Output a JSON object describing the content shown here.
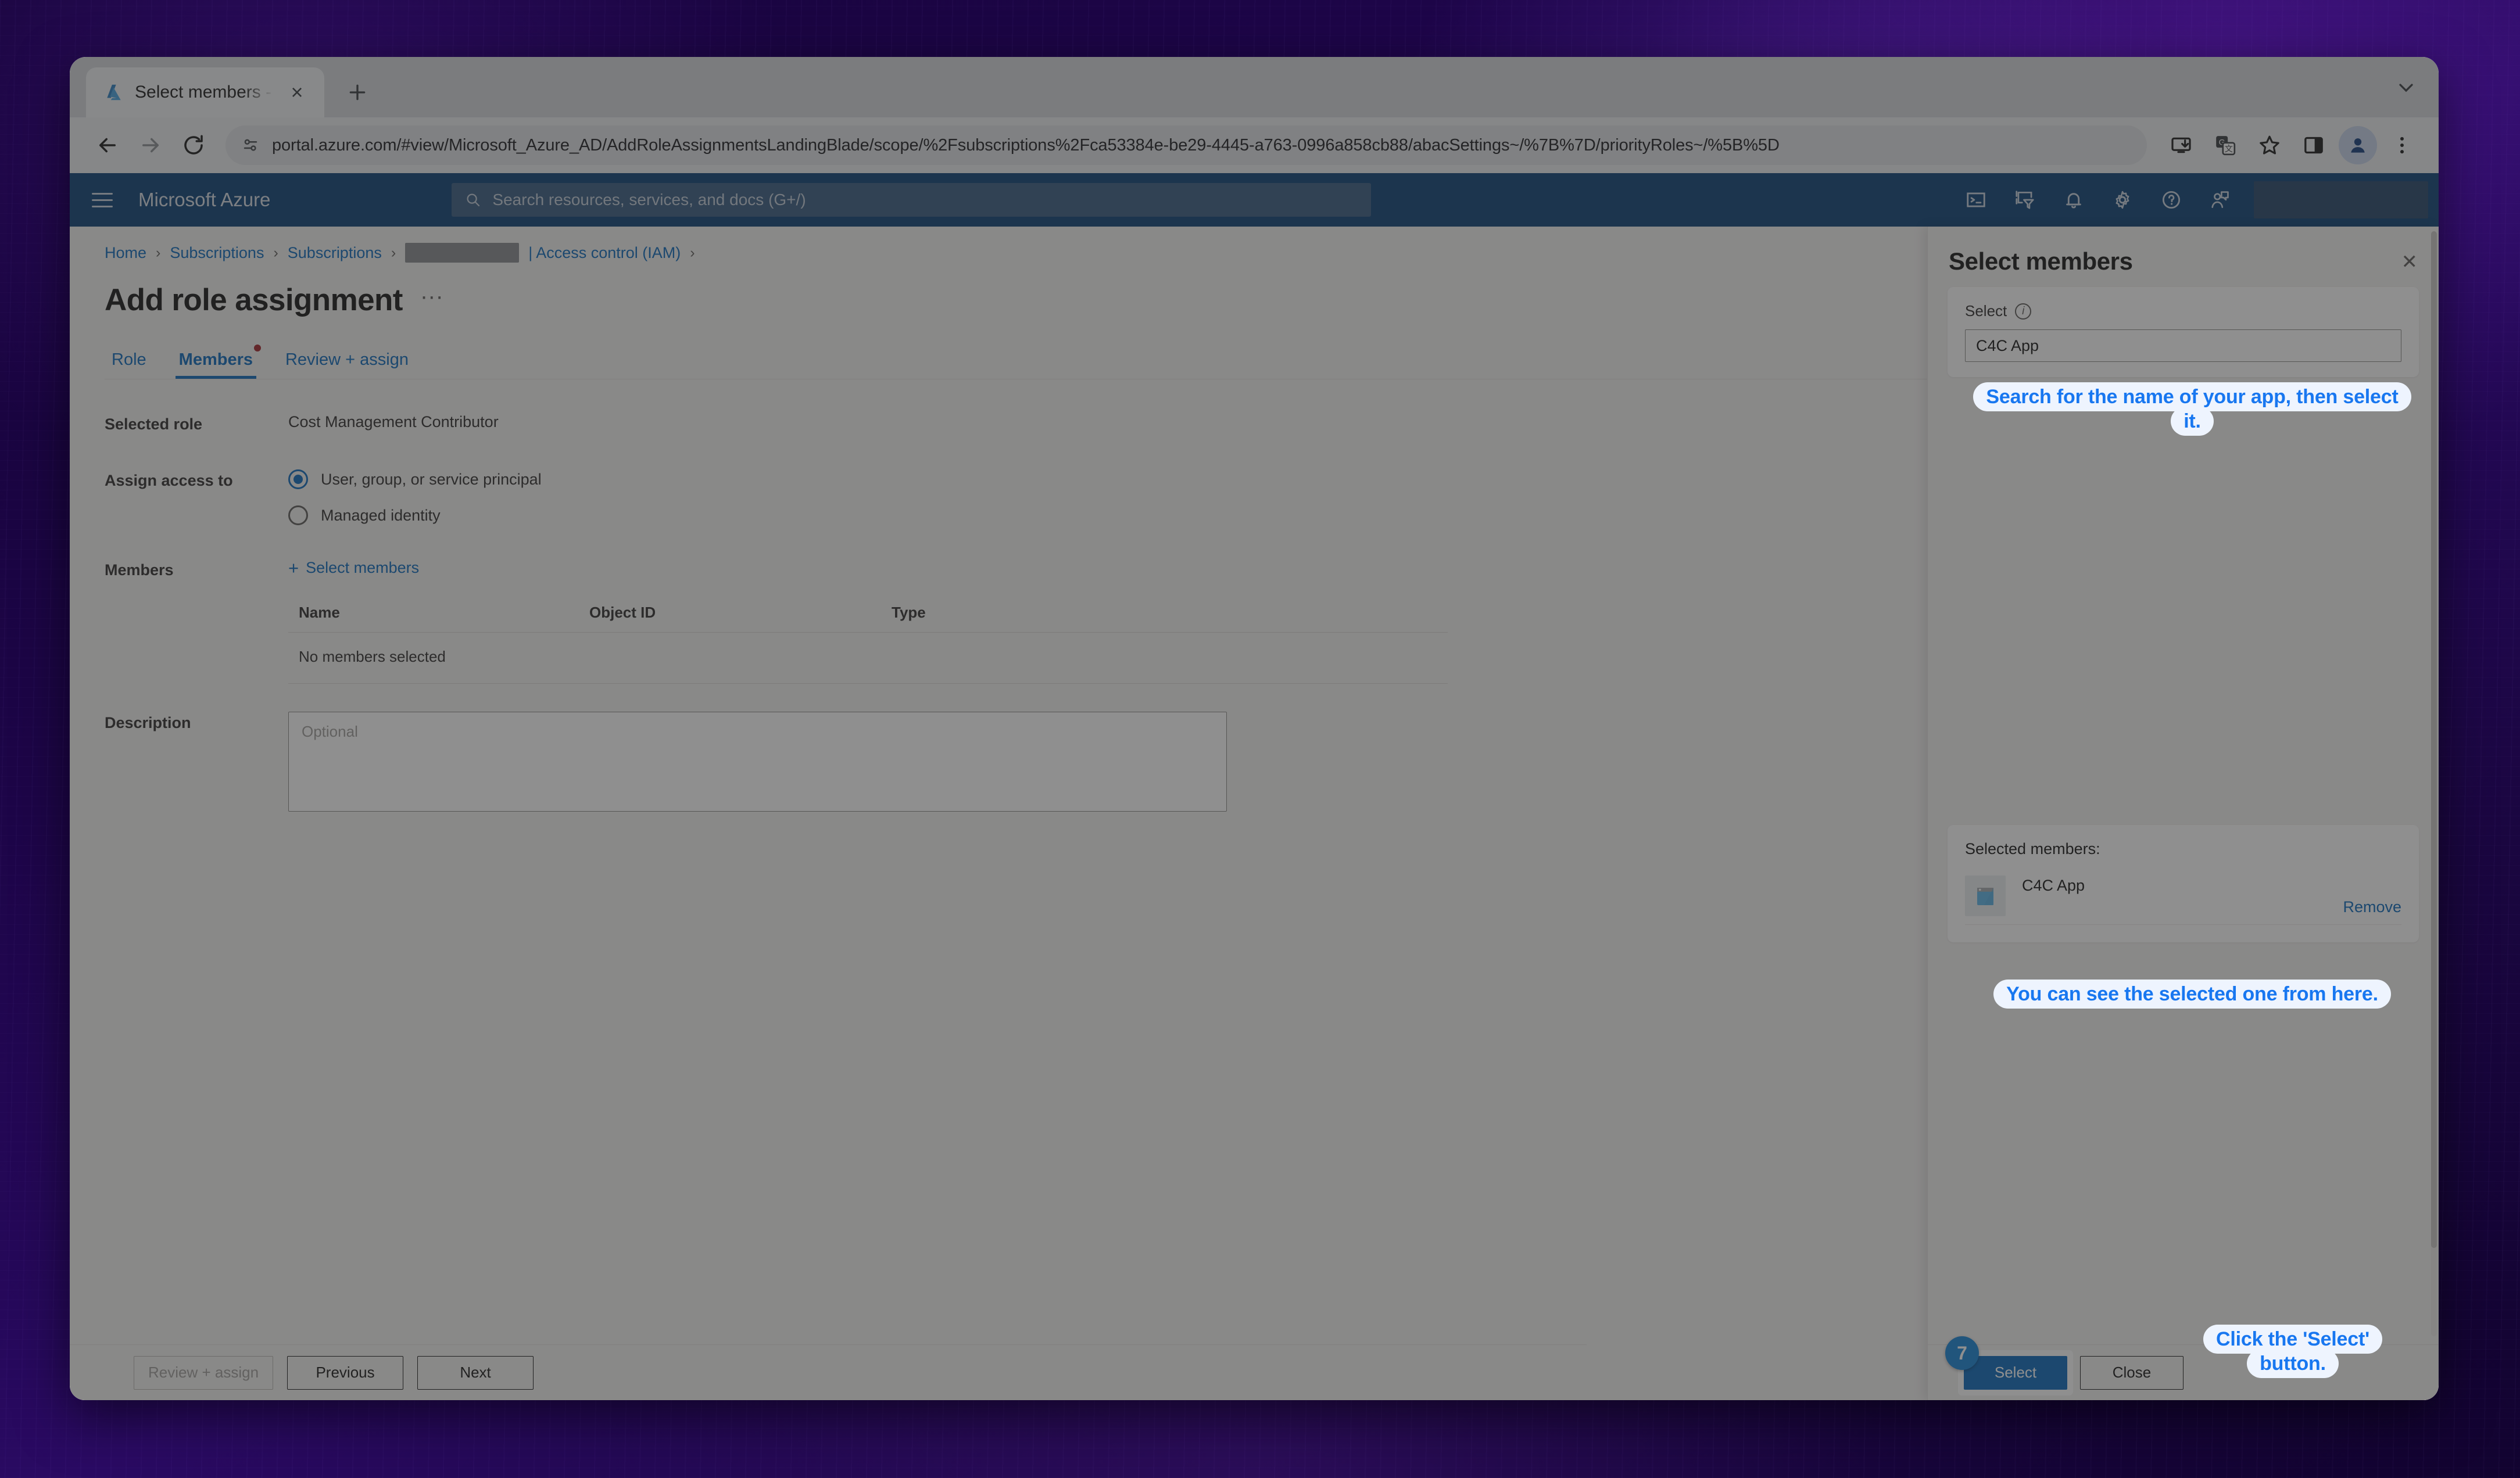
{
  "browser": {
    "tab": {
      "title": "Select members - Microsoft A",
      "favicon": "azure-logo-icon",
      "close": "×"
    },
    "newtab_label": "+",
    "window_chevron": "⌄",
    "nav": {
      "back": "←",
      "forward": "→",
      "reload": "⟳"
    },
    "omnibox": {
      "site_icon": "site-settings-icon",
      "url": "portal.azure.com/#view/Microsoft_Azure_AD/AddRoleAssignmentsLandingBlade/scope/%2Fsubscriptions%2Fca53384e-be29-4445-a763-0996a858cb88/abacSettings~/%7B%7D/priorityRoles~/%5B%5D"
    },
    "toolbar_icons": [
      "install-app-icon",
      "translate-icon",
      "bookmark-star-icon",
      "side-panel-icon",
      "profile-icon",
      "chrome-menu-icon"
    ]
  },
  "azure_header": {
    "menu": "hamburger-menu-icon",
    "brand": "Microsoft Azure",
    "search_placeholder": "Search resources, services, and docs (G+/)",
    "icons": [
      "cloud-shell-icon",
      "directory-filter-icon",
      "notifications-bell-icon",
      "settings-gear-icon",
      "help-question-icon",
      "feedback-icon"
    ]
  },
  "breadcrumb": {
    "items": [
      "Home",
      "Subscriptions",
      "Subscriptions"
    ],
    "redacted": "",
    "tail": "| Access control (IAM)",
    "separator": "›"
  },
  "page": {
    "title": "Add role assignment",
    "ellipsis": "···",
    "tabs": [
      {
        "label": "Role",
        "active": false,
        "required": false
      },
      {
        "label": "Members",
        "active": true,
        "required": true
      },
      {
        "label": "Review + assign",
        "active": false,
        "required": false
      }
    ],
    "fields": {
      "selected_role_label": "Selected role",
      "selected_role_value": "Cost Management Contributor",
      "assign_access_label": "Assign access to",
      "assign_options": [
        {
          "label": "User, group, or service principal",
          "checked": true
        },
        {
          "label": "Managed identity",
          "checked": false
        }
      ],
      "members_label": "Members",
      "select_members_link": "Select members",
      "select_members_plus": "+",
      "description_label": "Description",
      "description_placeholder": "Optional",
      "description_value": ""
    },
    "members_table": {
      "columns": [
        "Name",
        "Object ID",
        "Type"
      ],
      "empty_message": "No members selected",
      "rows": []
    },
    "footer_buttons": [
      {
        "label": "Review + assign",
        "disabled": true
      },
      {
        "label": "Previous",
        "disabled": false
      },
      {
        "label": "Next",
        "disabled": false
      }
    ]
  },
  "flyout": {
    "title": "Select members",
    "close": "✕",
    "select_label": "Select",
    "select_info_icon": "info-icon",
    "search_value": "C4C App",
    "selected_members_label": "Selected members:",
    "selected": [
      {
        "name": "C4C App",
        "icon": "app-registration-icon",
        "remove_label": "Remove"
      }
    ],
    "buttons": [
      {
        "label": "Select",
        "primary": true
      },
      {
        "label": "Close",
        "primary": false
      }
    ],
    "step_badge": "7"
  },
  "annotations": [
    {
      "id": "search-callout",
      "text": "Search for the name of your app, then select it."
    },
    {
      "id": "selected-callout",
      "text": "You can see the selected one from here."
    },
    {
      "id": "select-button-callout",
      "text": "Click the 'Select' button."
    }
  ],
  "colors": {
    "azure_header": "#0f4377",
    "accent_link": "#0f6cbd",
    "primary_button": "#0f6cbd",
    "annotation_blue": "#1877f0",
    "annotation_bg": "#eef4fe",
    "step_badge": "#1b86d8",
    "required_red": "#a4262c"
  }
}
